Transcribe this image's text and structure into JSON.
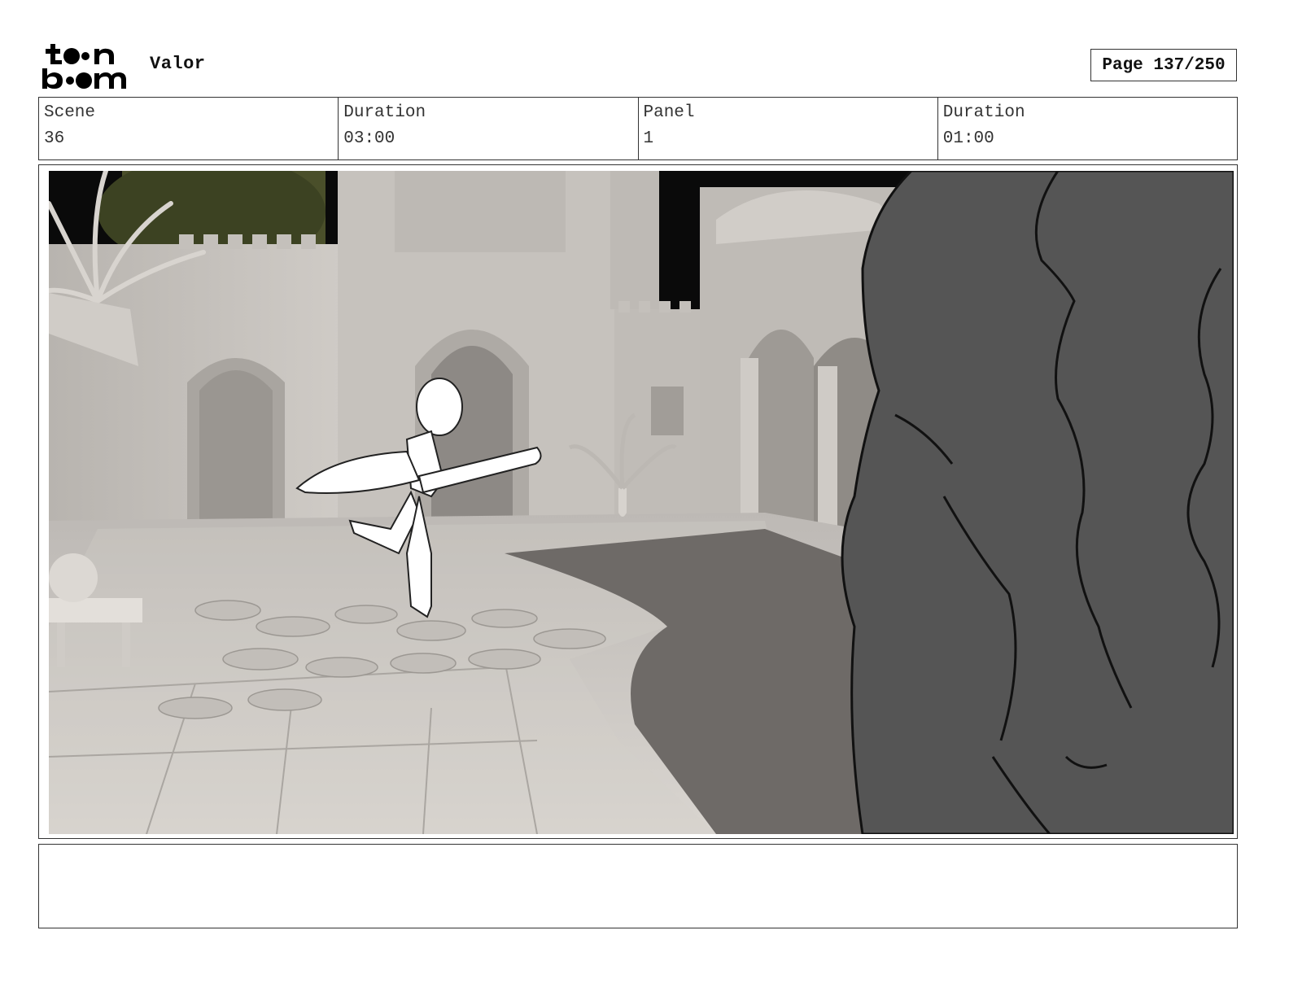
{
  "header": {
    "logo_text": "toonboom",
    "project_title": "Valor",
    "page_label": "Page 137/250"
  },
  "info": {
    "scene_label": "Scene",
    "scene_value": "36",
    "scene_duration_label": "Duration",
    "scene_duration_value": "03:00",
    "panel_label": "Panel",
    "panel_value": "1",
    "panel_duration_label": "Duration",
    "panel_duration_value": "01:00"
  },
  "notes": {
    "text": ""
  },
  "colors": {
    "border": "#333333",
    "sky": "#050505",
    "wall": "#c9c5c0",
    "ground": "#d8d4cf",
    "shadow": "#6f6b68",
    "creature": "#555555"
  }
}
